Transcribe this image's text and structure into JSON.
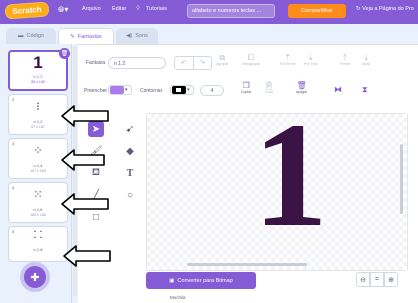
{
  "menubar": {
    "logo": "Scratch",
    "file": "Arquivo",
    "edit": "Editar",
    "tutorials": "Tutoriais",
    "project_title": "alfabeto e numeros teclas ...",
    "share": "Compartilhar",
    "see_project": "Veja a Página do Pro"
  },
  "tabs": {
    "code": "Código",
    "costumes": "Fantasias",
    "sounds": "Sons"
  },
  "costumes": [
    {
      "number": "1",
      "name": "n 1.2",
      "size": "86 x 168"
    },
    {
      "number": "2",
      "name": "n 1.2",
      "size": "67 x 167"
    },
    {
      "number": "3",
      "name": "n 1.4",
      "size": "107 x 168"
    },
    {
      "number": "4",
      "name": "n 1.6",
      "size": "189 x 158"
    },
    {
      "number": "5",
      "name": "n 1.8",
      "size": ""
    }
  ],
  "editor": {
    "costume_label": "Fantasia",
    "costume_name": "n 1.2",
    "group": "Agrupar",
    "ungroup": "Desagrupar",
    "forward": "Pra frente",
    "backward": "Pra Trás",
    "front": "Frente",
    "back": "Atrás",
    "fill_label": "Preencher",
    "outline_label": "Contornar",
    "outline_width": "4",
    "copy": "Copiar",
    "paste": "Colar",
    "delete": "Apagar",
    "convert_bitmap": "Converter para Bitmap",
    "glyph": "1",
    "fill_color": "#a97dea",
    "glyph_color": "#3a1244"
  },
  "footer": {
    "label": "Mochila"
  }
}
